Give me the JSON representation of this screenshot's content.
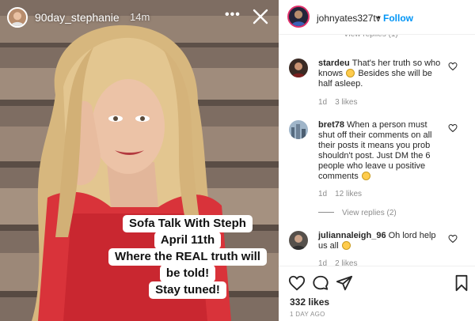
{
  "story": {
    "username": "90day_stephanie",
    "time": "14m",
    "more_icon": "more-horizontal-icon",
    "close_icon": "close-icon",
    "caption": [
      "Sofa Talk With Steph",
      "April 11th",
      "Where the REAL truth will",
      "be told!",
      "Stay tuned!"
    ]
  },
  "post": {
    "username": "johnyates327tv",
    "separator": "•",
    "follow_label": "Follow",
    "comments": [
      {
        "user": "stardeu",
        "text_before": "That's her truth so who knows",
        "emoji": "😳",
        "text_after": "Besides she will be half asleep.",
        "age": "1d",
        "likes": "3 likes"
      },
      {
        "user": "bret78",
        "text_before": "When a person must shut off their comments on all their posts it means you prob shouldn't post. Just DM the 6 people who leave u positive comments",
        "emoji": "😂",
        "text_after": "",
        "age": "1d",
        "likes": "12 likes",
        "view_replies": "View replies (2)"
      },
      {
        "user": "juliannaleigh_96",
        "text_before": "Oh lord help us all",
        "emoji": "🙄",
        "text_after": "",
        "age": "1d",
        "likes": "2 likes"
      }
    ],
    "likes_count": "332 likes",
    "posted_ago": "1 DAY AGO"
  },
  "colors": {
    "follow_blue": "#0095f6",
    "text": "#262626",
    "muted": "#8e8e8e",
    "divider": "#efefef"
  }
}
